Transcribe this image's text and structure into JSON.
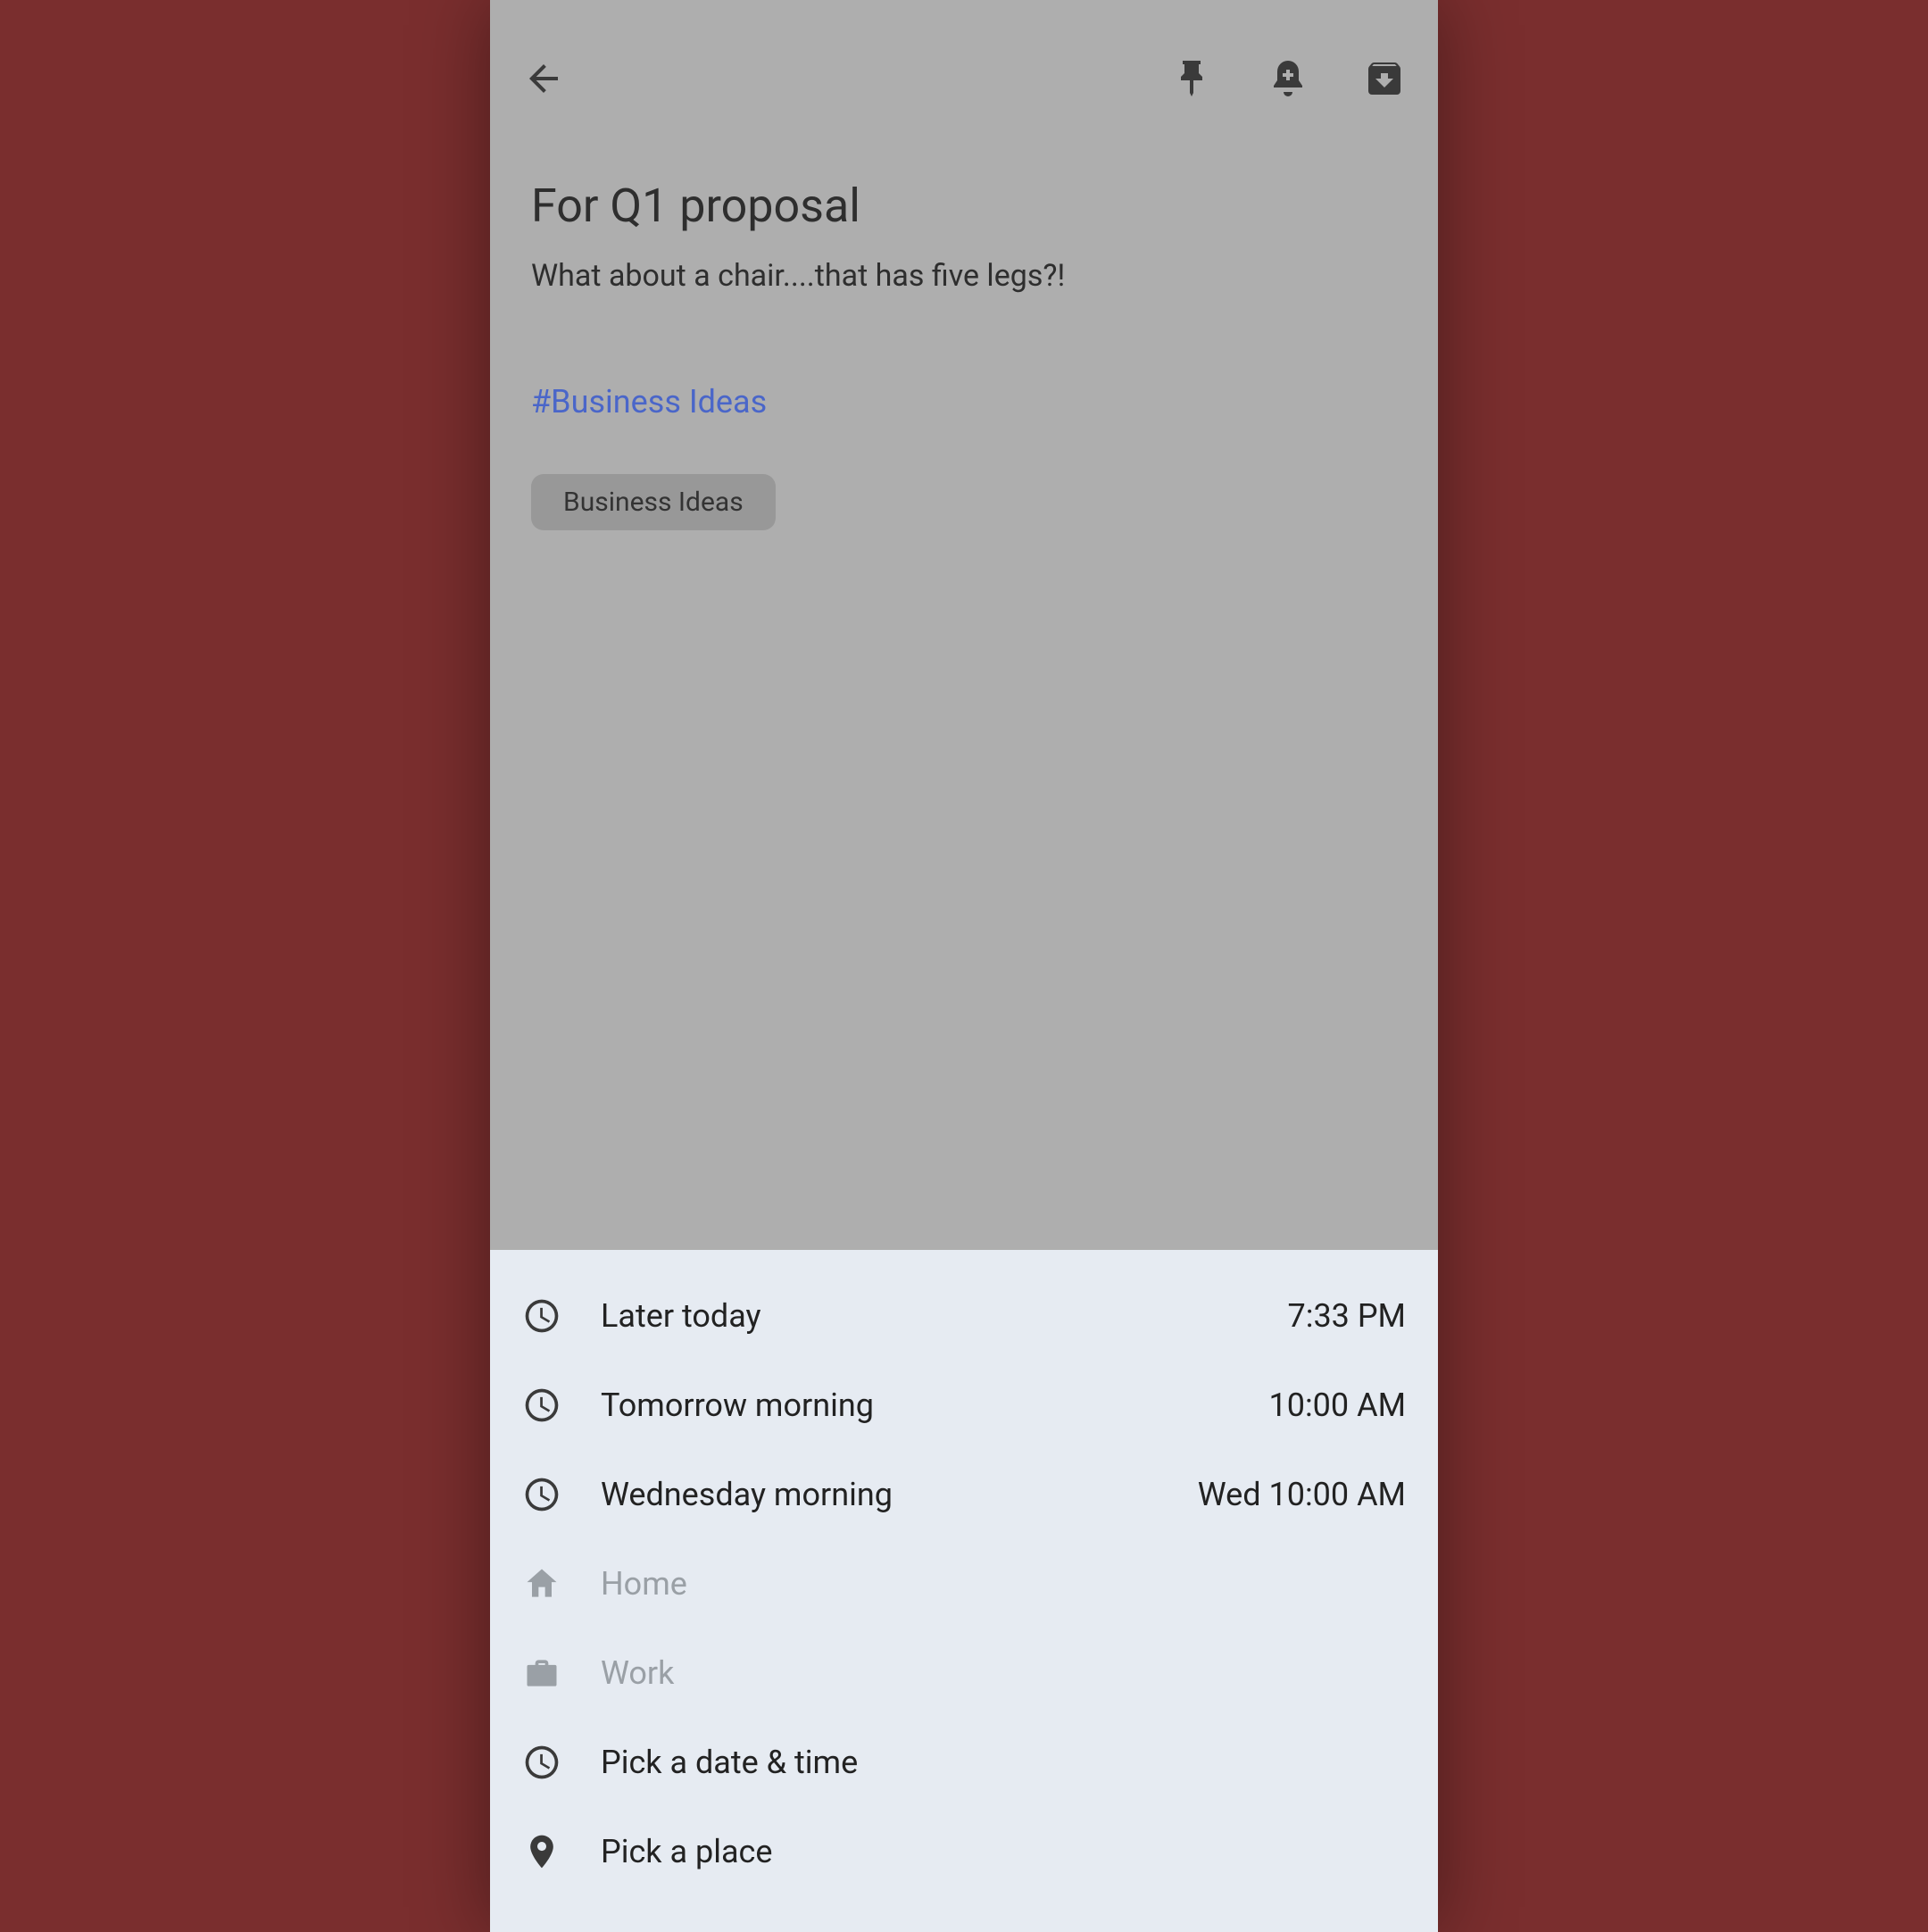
{
  "note": {
    "title": "For Q1 proposal",
    "body": "What about a chair....that has five legs?!",
    "hashlink": "#Business Ideas",
    "chip_label": "Business Ideas"
  },
  "toolbar": {
    "back": "Back",
    "pin": "Pin",
    "reminder": "Add reminder",
    "archive": "Archive"
  },
  "sheet": {
    "row0": {
      "label": "Later today",
      "time": "7:33 PM"
    },
    "row1": {
      "label": "Tomorrow morning",
      "time": "10:00 AM"
    },
    "row2": {
      "label": "Wednesday morning",
      "time": "Wed 10:00 AM"
    },
    "row3": {
      "label": "Home"
    },
    "row4": {
      "label": "Work"
    },
    "row5": {
      "label": "Pick a date & time"
    },
    "row6": {
      "label": "Pick a place"
    }
  }
}
